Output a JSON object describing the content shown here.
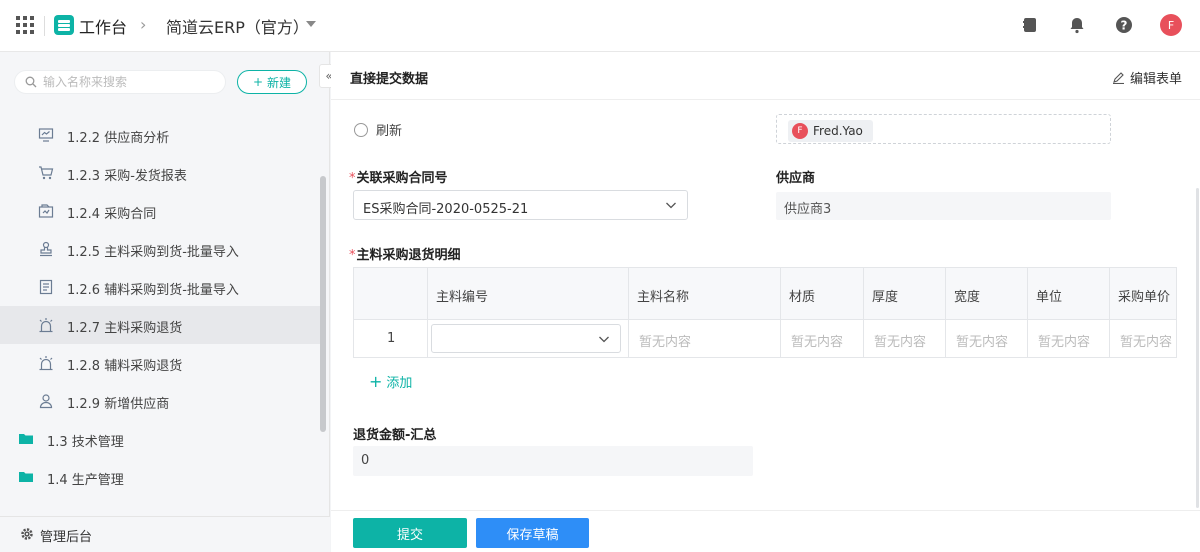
{
  "topbar": {
    "workspace_title": "工作台",
    "app_name": "简道云ERP（官方）",
    "avatar_initial": "F"
  },
  "sidebar": {
    "search_placeholder": "输入名称来搜索",
    "new_button": "新建",
    "items": [
      {
        "label": "1.2.2 供应商分析",
        "icon": "monitor-chart-icon",
        "type": "page"
      },
      {
        "label": "1.2.3 采购-发货报表",
        "icon": "cart-icon",
        "type": "page"
      },
      {
        "label": "1.2.4 采购合同",
        "icon": "contract-icon",
        "type": "page"
      },
      {
        "label": "1.2.5 主料采购到货-批量导入",
        "icon": "stamp-icon",
        "type": "page"
      },
      {
        "label": "1.2.6 辅料采购到货-批量导入",
        "icon": "document-icon",
        "type": "page"
      },
      {
        "label": "1.2.7 主料采购退货",
        "icon": "alarm-icon",
        "type": "page",
        "active": true
      },
      {
        "label": "1.2.8 辅料采购退货",
        "icon": "alarm-icon",
        "type": "page"
      },
      {
        "label": "1.2.9 新增供应商",
        "icon": "person-icon",
        "type": "page"
      },
      {
        "label": "1.3 技术管理",
        "icon": "folder-icon",
        "type": "folder"
      },
      {
        "label": "1.4 生产管理",
        "icon": "folder-icon",
        "type": "folder"
      }
    ],
    "footer_label": "管理后台"
  },
  "form": {
    "title": "直接提交数据",
    "edit_label": "编辑表单",
    "radio_option": "刷新",
    "member_name": "Fred.Yao",
    "member_initial": "F",
    "contract_label": "关联采购合同号",
    "contract_value": "ES采购合同-2020-0525-21",
    "supplier_label": "供应商",
    "supplier_value": "供应商3",
    "detail_label": "主料采购退货明细",
    "table": {
      "columns": [
        "主料编号",
        "主料名称",
        "材质",
        "厚度",
        "宽度",
        "单位",
        "采购单价"
      ],
      "row_number": "1",
      "empty_text": "暂无内容"
    },
    "add_label": "添加",
    "sum_label": "退货金额-汇总",
    "sum_value": "0",
    "submit_label": "提交",
    "draft_label": "保存草稿"
  },
  "colors": {
    "accent": "#0db3a6",
    "blue": "#2e8ef7",
    "avatar": "#e8505b"
  }
}
